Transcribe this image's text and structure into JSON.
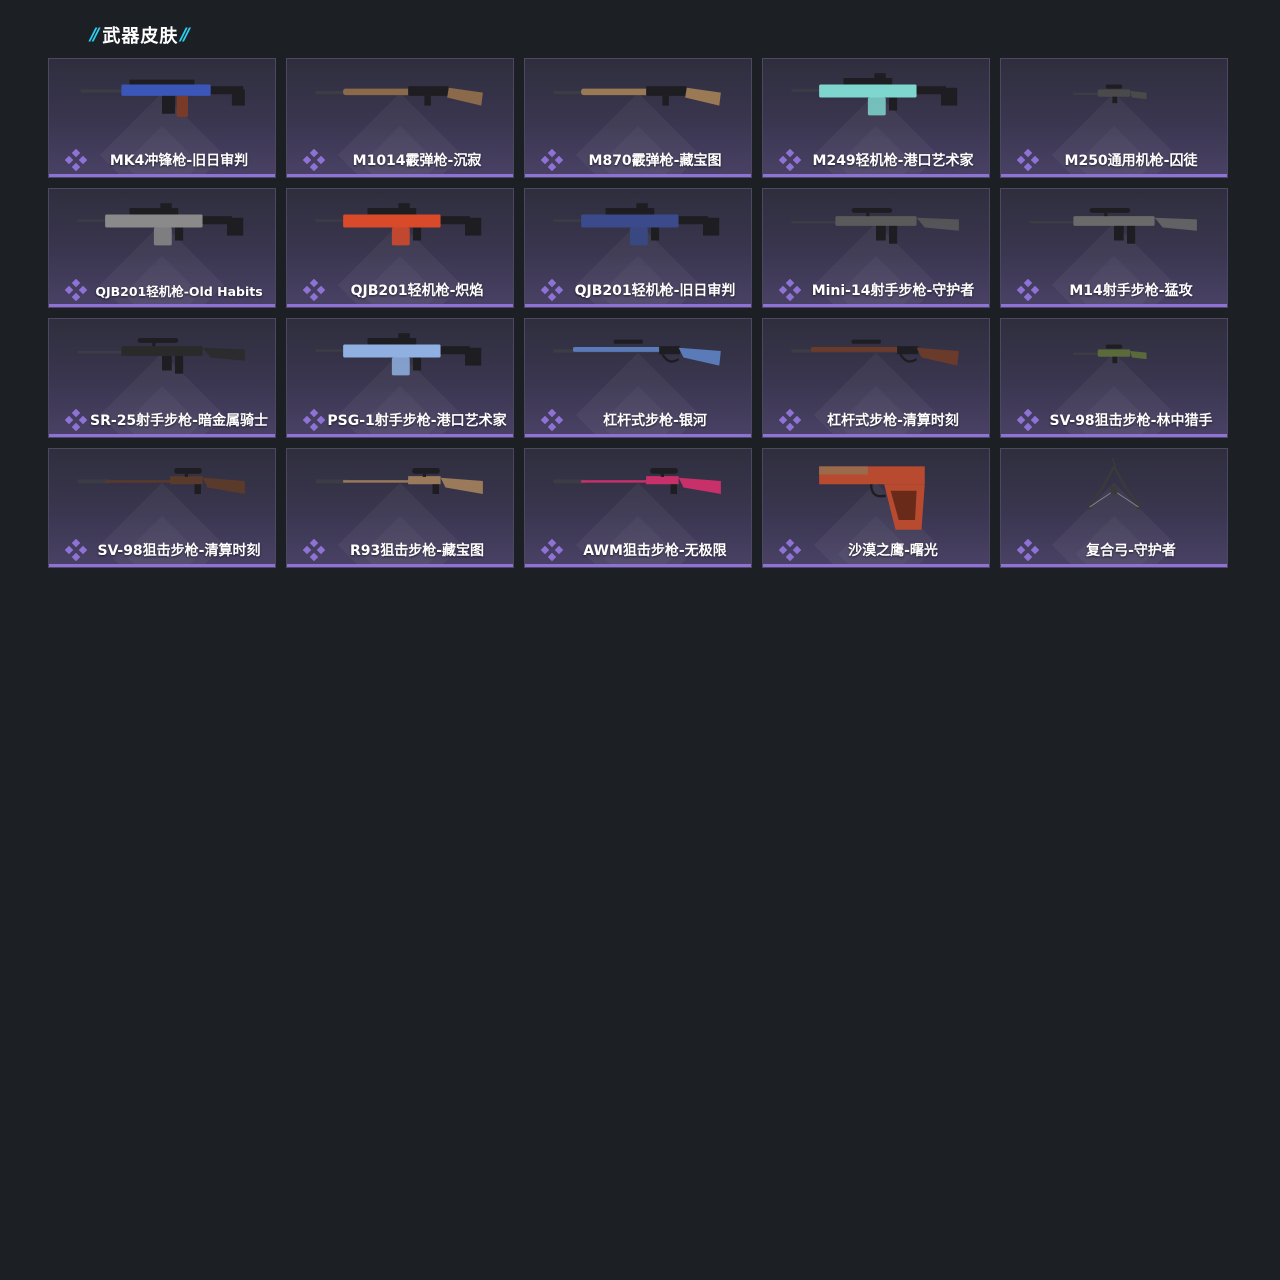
{
  "section": {
    "title": "武器皮肤",
    "accent_color": "#2ad1f2"
  },
  "colors": {
    "background": "#1c2024",
    "rarity": "#8f72d6"
  },
  "skins": [
    {
      "label": "MK4冲锋枪-旧日审判",
      "weapon": "rifle",
      "tint": "#3a56b8",
      "icon": "smg-icon"
    },
    {
      "label": "M1014霰弹枪-沉寂",
      "weapon": "shotgun",
      "tint": "#8a6a4a",
      "icon": "shotgun-icon"
    },
    {
      "label": "M870霰弹枪-藏宝图",
      "weapon": "shotgun",
      "tint": "#9a7a55",
      "icon": "shotgun-icon"
    },
    {
      "label": "M249轻机枪-港口艺术家",
      "weapon": "lmg",
      "tint": "#7fd6cf",
      "icon": "machine-gun-icon"
    },
    {
      "label": "M250通用机枪-囚徒",
      "weapon": "small-rifle",
      "tint": "#4a4a4a",
      "icon": "machine-gun-icon"
    },
    {
      "label": "QJB201轻机枪-Old Habits",
      "weapon": "lmg",
      "tint": "#8a8a8a",
      "icon": "machine-gun-icon"
    },
    {
      "label": "QJB201轻机枪-炽焰",
      "weapon": "lmg",
      "tint": "#d84a2a",
      "icon": "machine-gun-icon"
    },
    {
      "label": "QJB201轻机枪-旧日审判",
      "weapon": "lmg",
      "tint": "#3a4a8a",
      "icon": "machine-gun-icon"
    },
    {
      "label": "Mini-14射手步枪-守护者",
      "weapon": "marksman",
      "tint": "#5a5a5a",
      "icon": "rifle-icon"
    },
    {
      "label": "M14射手步枪-猛攻",
      "weapon": "marksman",
      "tint": "#6a6a6a",
      "icon": "rifle-icon"
    },
    {
      "label": "SR-25射手步枪-暗金属骑士",
      "weapon": "marksman",
      "tint": "#2a2a2a",
      "icon": "rifle-icon"
    },
    {
      "label": "PSG-1射手步枪-港口艺术家",
      "weapon": "lmg",
      "tint": "#8fb0e0",
      "icon": "rifle-icon"
    },
    {
      "label": "杠杆式步枪-银河",
      "weapon": "lever",
      "tint": "#5a7ab8",
      "icon": "rifle-icon"
    },
    {
      "label": "杠杆式步枪-清算时刻",
      "weapon": "lever",
      "tint": "#6a3a2a",
      "icon": "rifle-icon"
    },
    {
      "label": "SV-98狙击步枪-林中猎手",
      "weapon": "small-rifle",
      "tint": "#5a6a3a",
      "icon": "sniper-icon"
    },
    {
      "label": "SV-98狙击步枪-清算时刻",
      "weapon": "sniper",
      "tint": "#5a3a2a",
      "icon": "sniper-icon"
    },
    {
      "label": "R93狙击步枪-藏宝图",
      "weapon": "sniper",
      "tint": "#9a7a5a",
      "icon": "sniper-icon"
    },
    {
      "label": "AWM狙击步枪-无极限",
      "weapon": "sniper",
      "tint": "#c8306a",
      "icon": "sniper-icon"
    },
    {
      "label": "沙漠之鹰-曙光",
      "weapon": "pistol",
      "tint": "#b84a30",
      "icon": "pistol-icon"
    },
    {
      "label": "复合弓-守护者",
      "weapon": "bow",
      "tint": "#3a3a3a",
      "icon": "bow-icon"
    }
  ]
}
